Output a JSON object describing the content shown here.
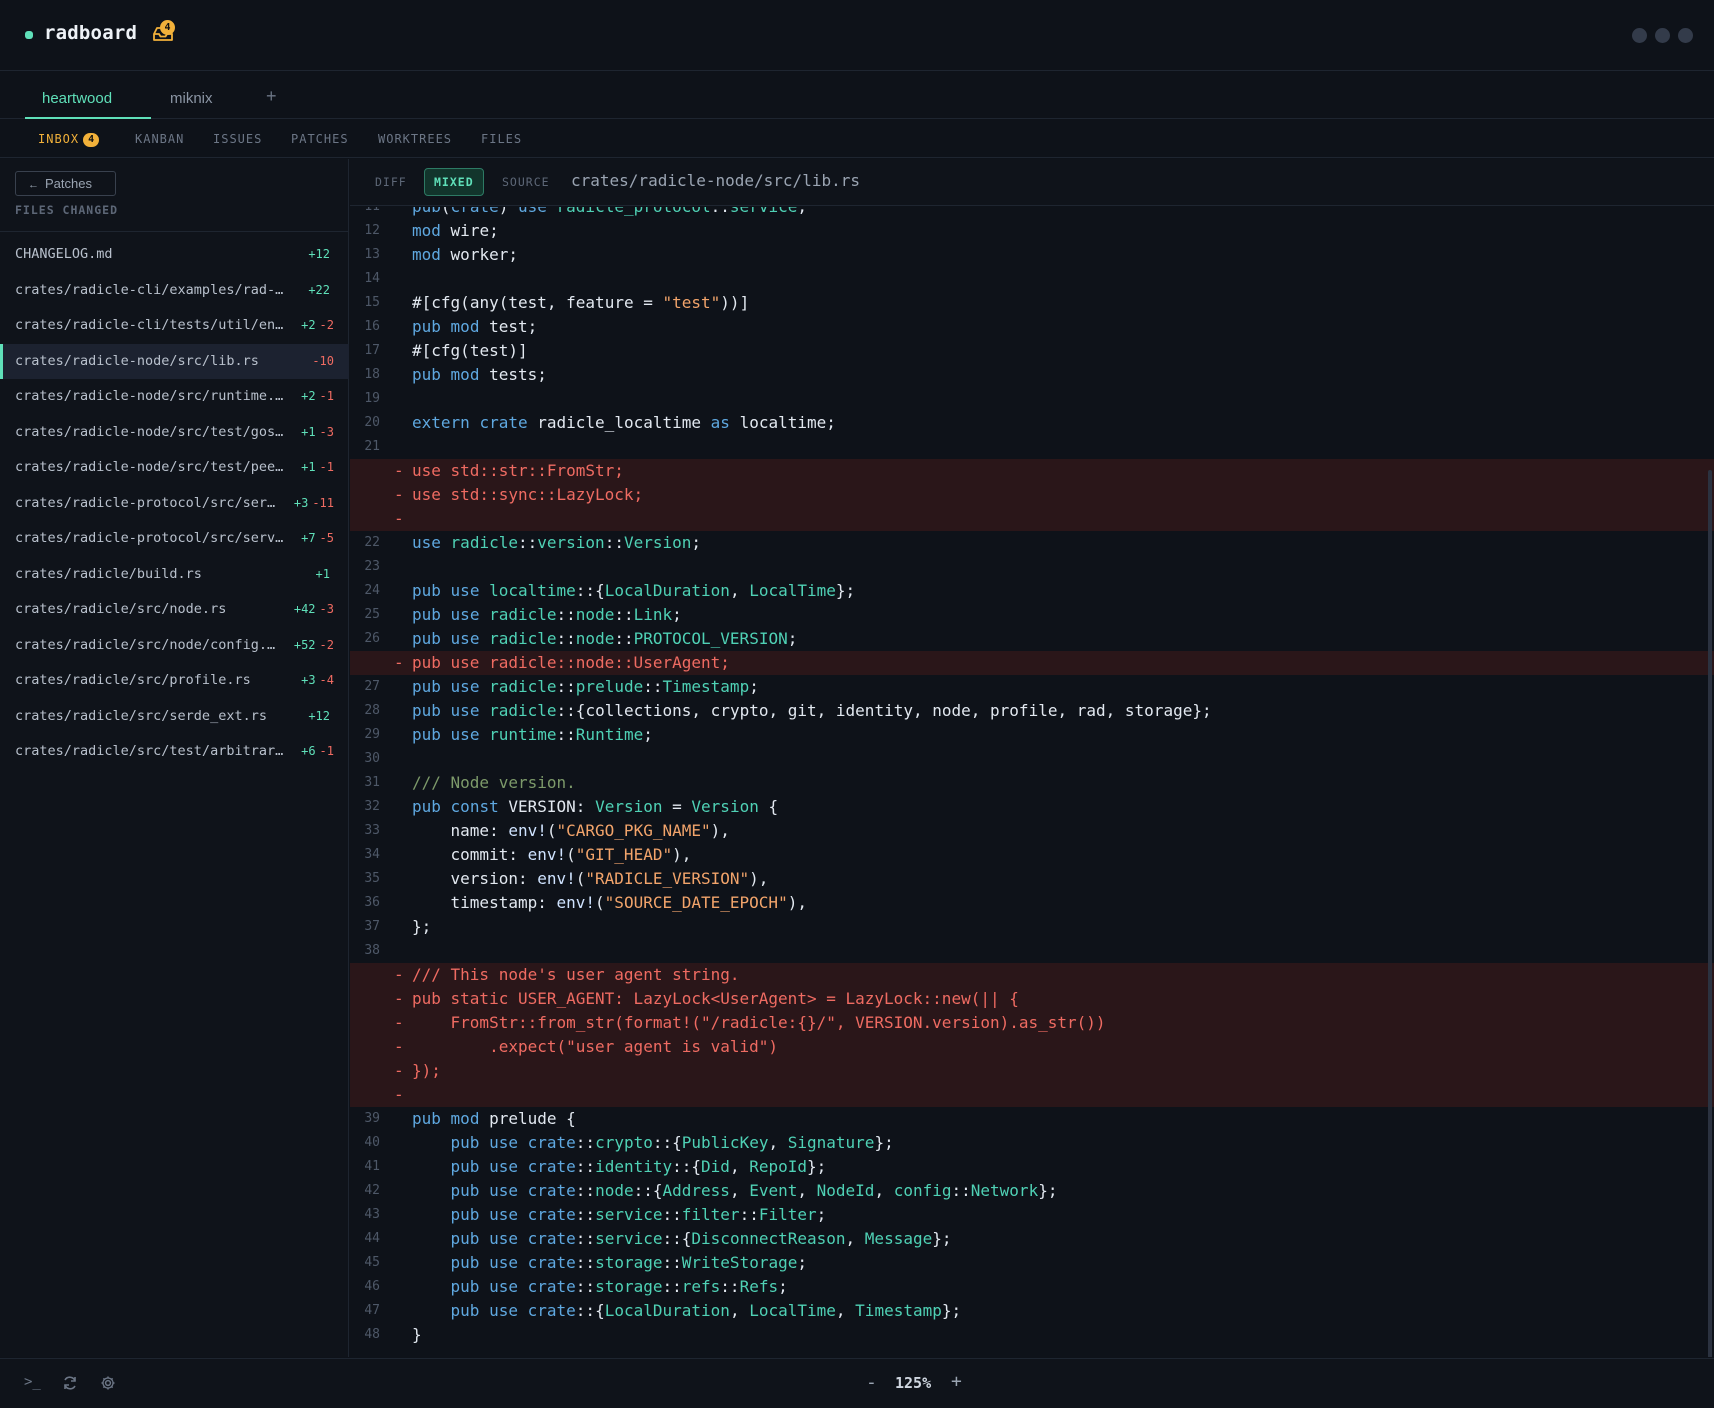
{
  "app": {
    "name": "radboard",
    "inbox_count": "4"
  },
  "repo_tabs": [
    {
      "label": "heartwood",
      "active": true
    },
    {
      "label": "miknix",
      "active": false
    }
  ],
  "repo_tab_add": "+",
  "section_tabs": [
    {
      "label": "INBOX",
      "badge": "4",
      "active": true
    },
    {
      "label": "KANBAN"
    },
    {
      "label": "ISSUES"
    },
    {
      "label": "PATCHES"
    },
    {
      "label": "WORKTREES"
    },
    {
      "label": "FILES"
    }
  ],
  "sidebar": {
    "back_label": "Patches",
    "files_title": "FILES CHANGED",
    "files": [
      {
        "name": "CHANGELOG.md",
        "add": "+12",
        "del": ""
      },
      {
        "name": "crates/radicle-cli/examples/rad-c…",
        "add": "+22",
        "del": ""
      },
      {
        "name": "crates/radicle-cli/tests/util/en…",
        "add": "+2",
        "del": "-2"
      },
      {
        "name": "crates/radicle-node/src/lib.rs",
        "add": "",
        "del": "-10",
        "selected": true
      },
      {
        "name": "crates/radicle-node/src/runtime.…",
        "add": "+2",
        "del": "-1"
      },
      {
        "name": "crates/radicle-node/src/test/gos…",
        "add": "+1",
        "del": "-3"
      },
      {
        "name": "crates/radicle-node/src/test/pee…",
        "add": "+1",
        "del": "-1"
      },
      {
        "name": "crates/radicle-protocol/src/ser…",
        "add": "+3",
        "del": "-11"
      },
      {
        "name": "crates/radicle-protocol/src/serv…",
        "add": "+7",
        "del": "-5"
      },
      {
        "name": "crates/radicle/build.rs",
        "add": "+1",
        "del": ""
      },
      {
        "name": "crates/radicle/src/node.rs",
        "add": "+42",
        "del": "-3"
      },
      {
        "name": "crates/radicle/src/node/config.…",
        "add": "+52",
        "del": "-2"
      },
      {
        "name": "crates/radicle/src/profile.rs",
        "add": "+3",
        "del": "-4"
      },
      {
        "name": "crates/radicle/src/serde_ext.rs",
        "add": "+12",
        "del": ""
      },
      {
        "name": "crates/radicle/src/test/arbitrar…",
        "add": "+6",
        "del": "-1"
      }
    ]
  },
  "viewer": {
    "modes": [
      {
        "label": "DIFF",
        "active": false
      },
      {
        "label": "MIXED",
        "active": true
      },
      {
        "label": "SOURCE",
        "active": false
      }
    ],
    "file_path": "crates/radicle-node/src/lib.rs",
    "lines": [
      {
        "n": "11",
        "t": "pub(crate) use radicle_protocol::service;"
      },
      {
        "n": "12",
        "t": "mod wire;"
      },
      {
        "n": "13",
        "t": "mod worker;"
      },
      {
        "n": "14",
        "t": ""
      },
      {
        "n": "15",
        "t": "#[cfg(any(test, feature = \"test\"))]"
      },
      {
        "n": "16",
        "t": "pub mod test;"
      },
      {
        "n": "17",
        "t": "#[cfg(test)]"
      },
      {
        "n": "18",
        "t": "pub mod tests;"
      },
      {
        "n": "19",
        "t": ""
      },
      {
        "n": "20",
        "t": "extern crate radicle_localtime as localtime;"
      },
      {
        "n": "21",
        "t": ""
      },
      {
        "n": "",
        "m": "-",
        "t": "use std::str::FromStr;",
        "removed": true
      },
      {
        "n": "",
        "m": "-",
        "t": "use std::sync::LazyLock;",
        "removed": true
      },
      {
        "n": "",
        "m": "-",
        "t": "",
        "removed": true
      },
      {
        "n": "22",
        "t": "use radicle::version::Version;"
      },
      {
        "n": "23",
        "t": ""
      },
      {
        "n": "24",
        "t": "pub use localtime::{LocalDuration, LocalTime};"
      },
      {
        "n": "25",
        "t": "pub use radicle::node::Link;"
      },
      {
        "n": "26",
        "t": "pub use radicle::node::PROTOCOL_VERSION;"
      },
      {
        "n": "",
        "m": "-",
        "t": "pub use radicle::node::UserAgent;",
        "removed": true
      },
      {
        "n": "27",
        "t": "pub use radicle::prelude::Timestamp;"
      },
      {
        "n": "28",
        "t": "pub use radicle::{collections, crypto, git, identity, node, profile, rad, storage};"
      },
      {
        "n": "29",
        "t": "pub use runtime::Runtime;"
      },
      {
        "n": "30",
        "t": ""
      },
      {
        "n": "31",
        "t": "/// Node version."
      },
      {
        "n": "32",
        "t": "pub const VERSION: Version = Version {"
      },
      {
        "n": "33",
        "t": "    name: env!(\"CARGO_PKG_NAME\"),"
      },
      {
        "n": "34",
        "t": "    commit: env!(\"GIT_HEAD\"),"
      },
      {
        "n": "35",
        "t": "    version: env!(\"RADICLE_VERSION\"),"
      },
      {
        "n": "36",
        "t": "    timestamp: env!(\"SOURCE_DATE_EPOCH\"),"
      },
      {
        "n": "37",
        "t": "};"
      },
      {
        "n": "38",
        "t": ""
      },
      {
        "n": "",
        "m": "-",
        "t": "/// This node's user agent string.",
        "removed": true
      },
      {
        "n": "",
        "m": "-",
        "t": "pub static USER_AGENT: LazyLock<UserAgent> = LazyLock::new(|| {",
        "removed": true
      },
      {
        "n": "",
        "m": "-",
        "t": "    FromStr::from_str(format!(\"/radicle:{}/\", VERSION.version).as_str())",
        "removed": true
      },
      {
        "n": "",
        "m": "-",
        "t": "        .expect(\"user agent is valid\")",
        "removed": true
      },
      {
        "n": "",
        "m": "-",
        "t": "});",
        "removed": true
      },
      {
        "n": "",
        "m": "-",
        "t": "",
        "removed": true
      },
      {
        "n": "39",
        "t": "pub mod prelude {"
      },
      {
        "n": "40",
        "t": "    pub use crate::crypto::{PublicKey, Signature};"
      },
      {
        "n": "41",
        "t": "    pub use crate::identity::{Did, RepoId};"
      },
      {
        "n": "42",
        "t": "    pub use crate::node::{Address, Event, NodeId, config::Network};"
      },
      {
        "n": "43",
        "t": "    pub use crate::service::filter::Filter;"
      },
      {
        "n": "44",
        "t": "    pub use crate::service::{DisconnectReason, Message};"
      },
      {
        "n": "45",
        "t": "    pub use crate::storage::WriteStorage;"
      },
      {
        "n": "46",
        "t": "    pub use crate::storage::refs::Refs;"
      },
      {
        "n": "47",
        "t": "    pub use crate::{LocalDuration, LocalTime, Timestamp};"
      },
      {
        "n": "48",
        "t": "}"
      }
    ]
  },
  "bottom": {
    "terminal_icon": ">_",
    "zoom_minus": "-",
    "zoom_value": "125%",
    "zoom_plus": "+"
  },
  "colors": {
    "accent": "#5fe0b9",
    "warning": "#f2b13a",
    "removed": "#ef6b62",
    "background": "#0e1219"
  }
}
